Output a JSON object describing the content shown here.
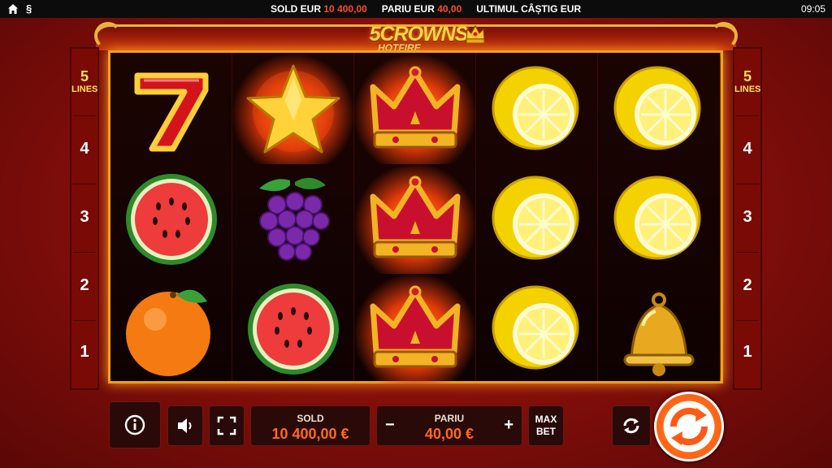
{
  "topbar": {
    "home_icon": "home-icon",
    "paragraph_icon": "§",
    "sold_label": "SOLD EUR",
    "sold_value": "10 400,00",
    "pariu_label": "PARIU EUR",
    "pariu_value": "40,00",
    "last_win_label": "ULTIMUL CÂȘTIG EUR",
    "time": "09:05"
  },
  "logo": {
    "line1": "5CROWNS",
    "line2": "HOTFIRE"
  },
  "lines": {
    "top_number": "5",
    "top_label": "LINES",
    "numbers": [
      "4",
      "3",
      "2",
      "1"
    ]
  },
  "reels": [
    [
      "seven",
      "watermelon",
      "orange"
    ],
    [
      "star",
      "grapes",
      "watermelon"
    ],
    [
      "crown",
      "crown",
      "crown"
    ],
    [
      "lemon",
      "lemon",
      "lemon"
    ],
    [
      "lemon",
      "lemon",
      "bell"
    ]
  ],
  "controls": {
    "sold_caption": "SOLD",
    "sold_amount": "10 400,00 €",
    "pariu_caption": "PARIU",
    "pariu_amount": "40,00 €",
    "minus": "−",
    "plus": "+",
    "maxbet_line1": "MAX",
    "maxbet_line2": "BET"
  },
  "colors": {
    "accent": "#ff6a1a",
    "frame_gold": "#f0a020",
    "background_red": "#8a0f0b"
  }
}
